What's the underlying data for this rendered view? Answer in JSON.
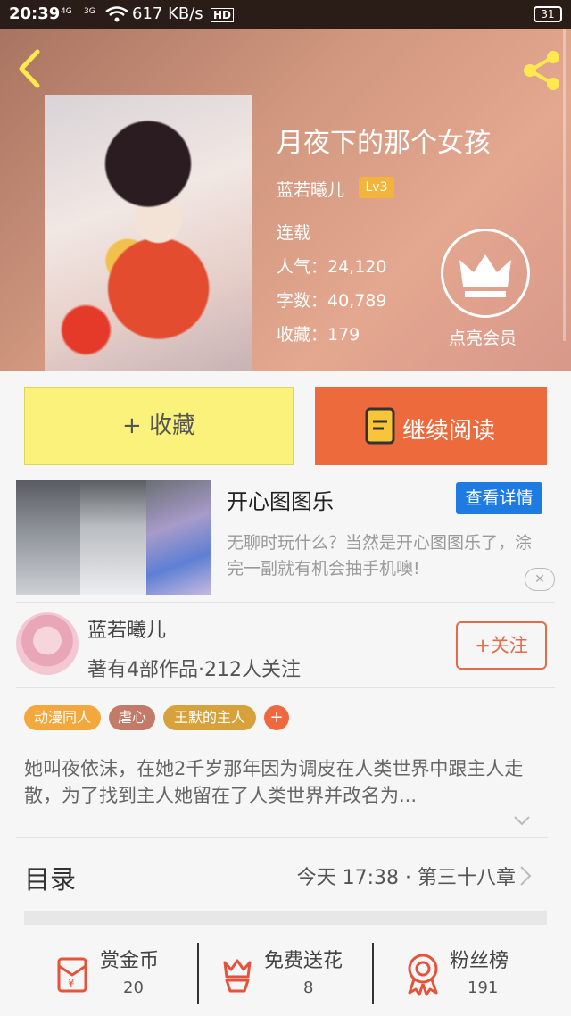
{
  "status_bar": {
    "time": "20:39",
    "signal1": "4G",
    "signal2": "3G",
    "speed": "617 KB/s",
    "hd": "HD",
    "battery": "31"
  },
  "book": {
    "title": "月夜下的那个女孩",
    "author": "蓝若曦儿",
    "level": "Lv3",
    "status": "连载",
    "popularity": "人气：24,120",
    "word_count": "字数：40,789",
    "favorites": "收藏：179",
    "member_label": "点亮会员"
  },
  "actions": {
    "collect": "+ 收藏",
    "continue_reading": "继续阅读"
  },
  "ad": {
    "title": "开心图图乐",
    "detail_button": "查看详情",
    "description": "无聊时玩什么？当然是开心图图乐了，涂完一副就有机会抽手机噢!",
    "close": "✕"
  },
  "author_info": {
    "name": "蓝若曦儿",
    "stats": "著有4部作品·212人关注",
    "follow": "+关注"
  },
  "tags": [
    {
      "label": "动漫同人",
      "color": "#f2a83c"
    },
    {
      "label": "虐心",
      "color": "#c47a69"
    },
    {
      "label": "王默的主人",
      "color": "#d7a23b"
    }
  ],
  "tag_add": "+",
  "summary": "她叫夜依沫，在她2千岁那年因为调皮在人类世界中跟主人走散，为了找到主人她留在了人类世界并改名为...",
  "toc": {
    "label": "目录",
    "update": "今天 17:38 · 第三十八章"
  },
  "bottom": [
    {
      "label": "赏金币",
      "count": "20"
    },
    {
      "label": "免费送花",
      "count": "8"
    },
    {
      "label": "粉丝榜",
      "count": "191"
    }
  ],
  "colors": {
    "accent_orange": "#ec6a3c",
    "accent_yellow": "#faf27a",
    "ad_blue": "#1e7be2",
    "icon_red": "#e4533a"
  }
}
